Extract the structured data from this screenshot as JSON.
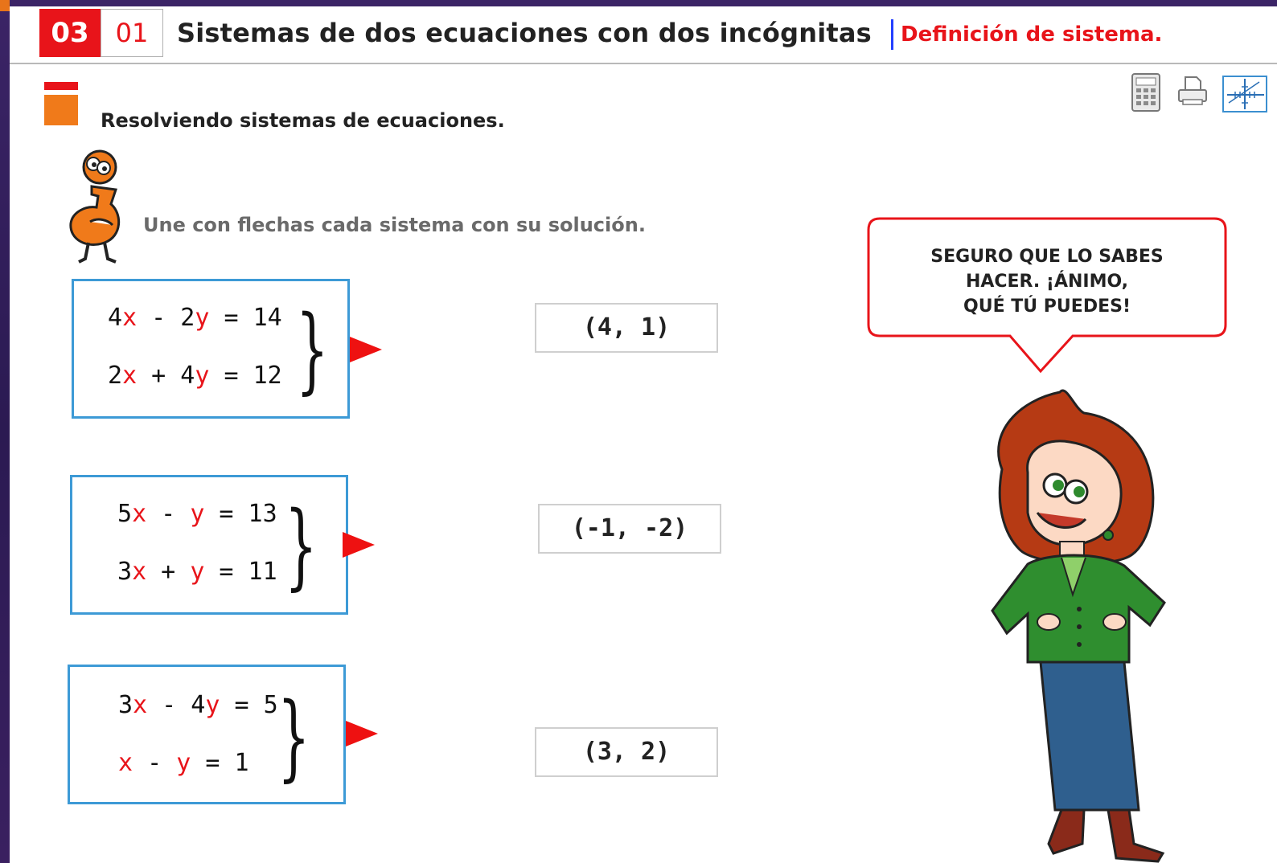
{
  "header": {
    "unit_number": "03",
    "lesson_number": "01",
    "title": "Sistemas de dos ecuaciones con dos incógnitas",
    "subtitle": "Definición de sistema."
  },
  "section": {
    "title": "Resolviendo sistemas de ecuaciones."
  },
  "toolbar": {
    "items": [
      {
        "name": "calculator-icon"
      },
      {
        "name": "print-icon"
      },
      {
        "name": "graph-icon"
      }
    ]
  },
  "instruction": "Une con flechas cada sistema con su solución.",
  "systems": [
    {
      "eq1": [
        "4",
        "x",
        " - 2",
        "y",
        " = 14"
      ],
      "eq2": [
        "2",
        "x",
        " + 4",
        "y",
        " = 12"
      ]
    },
    {
      "eq1": [
        "5",
        "x",
        " - ",
        "y",
        " = 13"
      ],
      "eq2": [
        "3",
        "x",
        " + ",
        "y",
        " = 11"
      ]
    },
    {
      "eq1": [
        "3",
        "x",
        " - 4",
        "y",
        " = 5"
      ],
      "eq2": [
        "",
        "x",
        " - ",
        "y",
        " = 1"
      ]
    }
  ],
  "solutions": [
    "(4, 1)",
    "(-1, -2)",
    "(3, 2)"
  ],
  "bubble": {
    "lines": [
      "SEGURO QUE LO SABES",
      "HACER. ¡ÁNIMO,",
      "QUÉ TÚ PUEDES!"
    ]
  },
  "colors": {
    "accent_red": "#e8141a",
    "box_border": "#3d9ad6",
    "arrow": "#ee1111",
    "marker_orange": "#f07a1a"
  }
}
